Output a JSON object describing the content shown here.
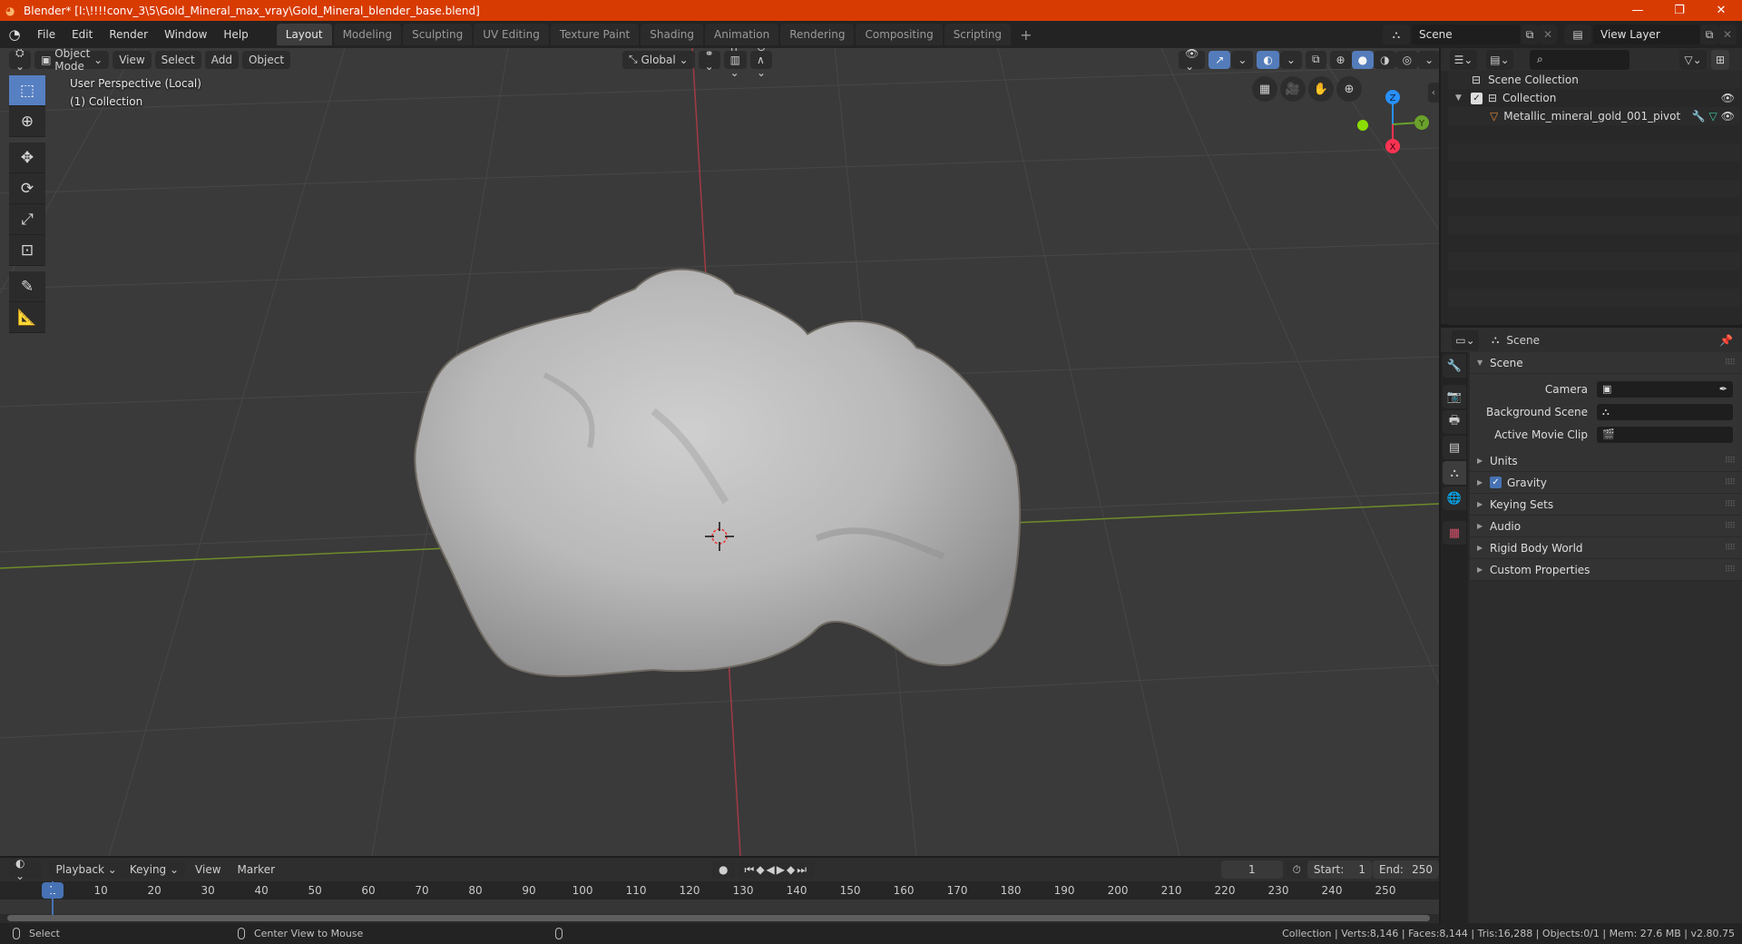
{
  "window": {
    "title": "Blender* [I:\\!!!!conv_3\\5\\Gold_Mineral_max_vray\\Gold_Mineral_blender_base.blend]",
    "controls": [
      "minimize",
      "maximize",
      "close"
    ]
  },
  "menubar": {
    "items": [
      "File",
      "Edit",
      "Render",
      "Window",
      "Help"
    ]
  },
  "workspaces": {
    "tabs": [
      "Layout",
      "Modeling",
      "Sculpting",
      "UV Editing",
      "Texture Paint",
      "Shading",
      "Animation",
      "Rendering",
      "Compositing",
      "Scripting"
    ],
    "active": "Layout",
    "add_label": "+"
  },
  "scene_selector": {
    "value": "Scene"
  },
  "viewlayer_selector": {
    "value": "View Layer"
  },
  "viewport": {
    "mode": "Object Mode",
    "menus": [
      "View",
      "Select",
      "Add",
      "Object"
    ],
    "orientation": "Global",
    "overlay_line1": "User Perspective (Local)",
    "overlay_line2": "(1) Collection",
    "tools": [
      "select-box",
      "cursor",
      "move",
      "rotate",
      "scale",
      "transform",
      "annotate",
      "measure"
    ],
    "active_tool": "select-box",
    "gizmo_axes": [
      "Z",
      "Y",
      "X"
    ],
    "colors": {
      "x_axis": "#ff3352",
      "y_axis": "#8bdc00",
      "z_axis": "#2890ff",
      "background": "#3a3a3a"
    }
  },
  "outliner": {
    "root": "Scene Collection",
    "items": [
      {
        "label": "Collection",
        "type": "collection",
        "checked": true,
        "visible": true
      },
      {
        "label": "Metallic_mineral_gold_001_pivot",
        "type": "object",
        "visible": true
      }
    ]
  },
  "properties": {
    "context": "Scene",
    "panel_title": "Scene",
    "fields": [
      {
        "label": "Camera",
        "value": ""
      },
      {
        "label": "Background Scene",
        "value": ""
      },
      {
        "label": "Active Movie Clip",
        "value": ""
      }
    ],
    "subpanels": [
      {
        "label": "Units"
      },
      {
        "label": "Gravity",
        "checked": true
      },
      {
        "label": "Keying Sets"
      },
      {
        "label": "Audio"
      },
      {
        "label": "Rigid Body World"
      },
      {
        "label": "Custom Properties"
      }
    ]
  },
  "timeline": {
    "menus": [
      "Playback",
      "Keying",
      "View",
      "Marker"
    ],
    "current_frame": "1",
    "start_label": "Start:",
    "start": "1",
    "end_label": "End:",
    "end": "250",
    "ruler": [
      "10",
      "20",
      "30",
      "40",
      "50",
      "60",
      "70",
      "80",
      "90",
      "100",
      "110",
      "120",
      "130",
      "140",
      "150",
      "160",
      "170",
      "180",
      "190",
      "200",
      "210",
      "220",
      "230",
      "240",
      "250"
    ],
    "ruler_current": "1"
  },
  "statusbar": {
    "left_action": "Select",
    "middle_action": "Center View to Mouse",
    "stats": "Collection | Verts:8,146 | Faces:8,144 | Tris:16,288 | Objects:0/1 | Mem: 27.6 MB | v2.80.75"
  }
}
